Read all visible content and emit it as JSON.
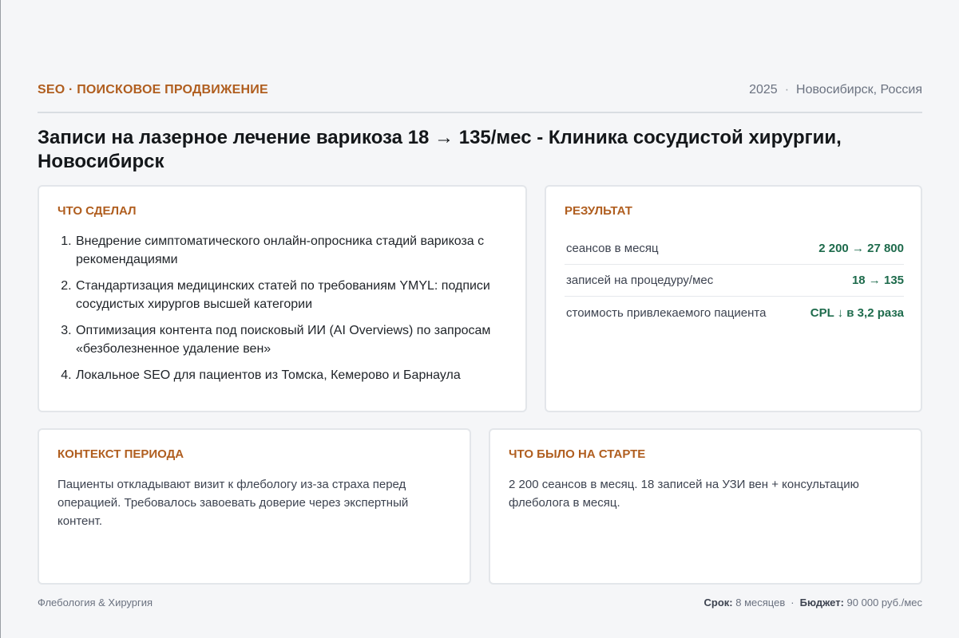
{
  "header": {
    "kicker": "SEO · ПОИСКОВОЕ ПРОДВИЖЕНИЕ",
    "year": "2025",
    "separator": "·",
    "location": "Новосибирск, Россия"
  },
  "title": "Записи на лазерное лечение варикоза 18 → 135/мес - Клиника сосудистой хирургии, Новосибирск",
  "did": {
    "label": "Что сделал",
    "items": [
      "Внедрение симптоматического онлайн-опросника стадий варикоза с рекомендациями",
      "Стандартизация медицинских статей по требованиям YMYL: подписи сосудистых хирургов высшей категории",
      "Оптимизация контента под поисковый ИИ (AI Overviews) по запросам «безболезненное удаление вен»",
      "Локальное SEO для пациентов из Томска, Кемерово и Барнаула"
    ]
  },
  "result": {
    "label": "Результат",
    "rows": [
      {
        "label": "сеансов в месяц",
        "value": "2 200 → 27 800"
      },
      {
        "label": "записей на процедуру/мес",
        "value": "18 → 135"
      },
      {
        "label": "стоимость привлекаемого пациента",
        "value": "CPL ↓ в 3,2 раза"
      }
    ]
  },
  "context": {
    "label": "Контекст периода",
    "text": "Пациенты откладывают визит к флебологу из-за страха перед операцией. Требовалось завоевать доверие через экспертный контент."
  },
  "start": {
    "label": "Что было на старте",
    "text": "2 200 сеансов в месяц. 18 записей на УЗИ вен + консультацию флеболога в месяц."
  },
  "footer": {
    "category": "Флебология & Хирургия",
    "term_label": "Срок:",
    "term_value": "8 месяцев",
    "separator": "·",
    "budget_label": "Бюджет:",
    "budget_value": "90 000 руб./мес"
  },
  "colors": {
    "accent": "#b05e1f",
    "positive": "#1e6b4c",
    "background": "#f5f6f8"
  }
}
